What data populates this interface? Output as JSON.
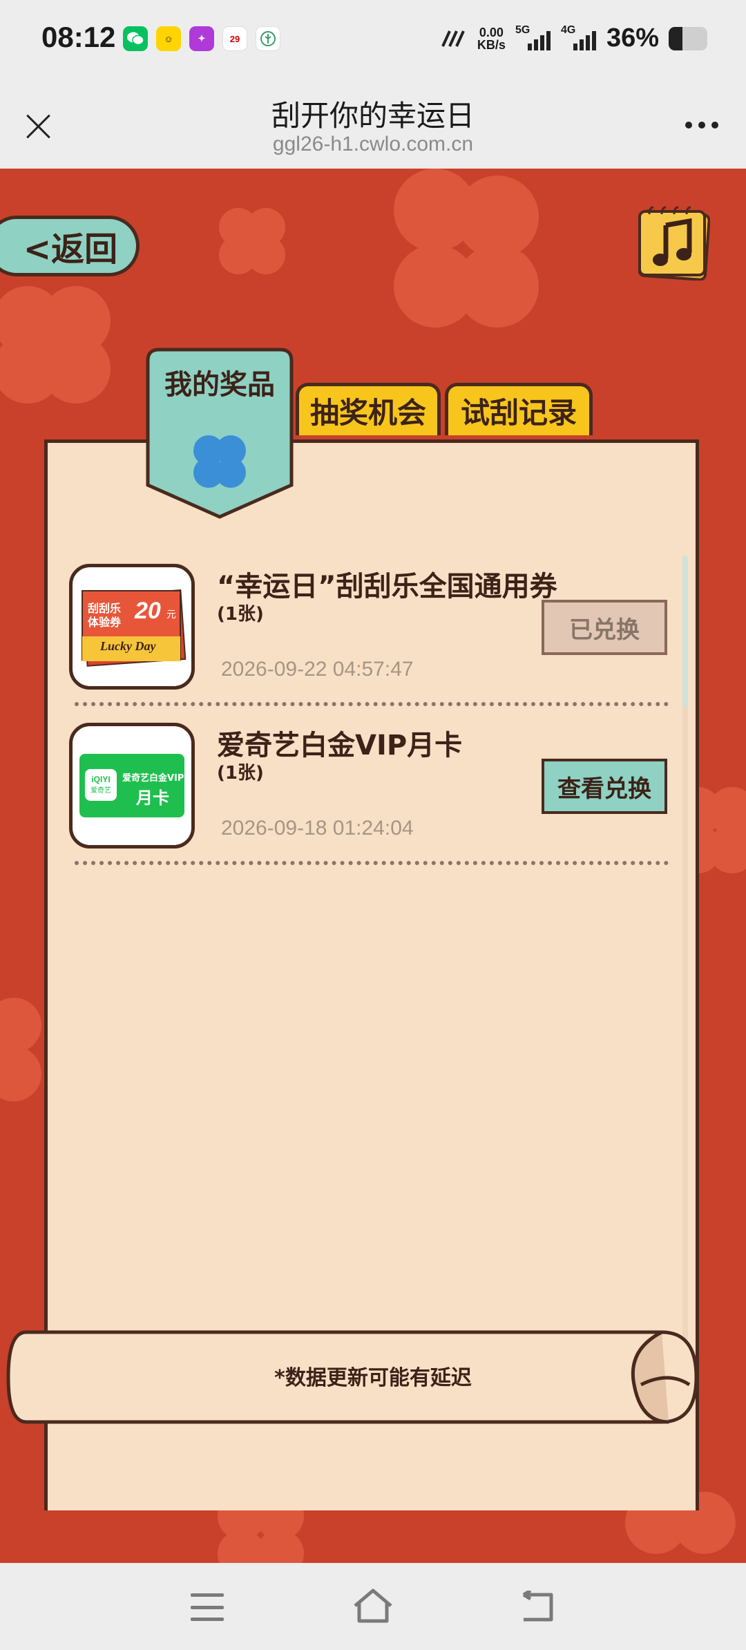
{
  "status_bar": {
    "time": "08:12",
    "net_speed_value": "0.00",
    "net_speed_unit": "KB/s",
    "sim1_label": "5G",
    "sim2_label": "4G",
    "battery_percent": "36%",
    "notif_text_4": "29"
  },
  "title_bar": {
    "title": "刮开你的幸运日",
    "url": "ggl26-h1.cwlo.com.cn"
  },
  "game": {
    "back_label": "<返回",
    "tabs": {
      "active": "我的奖品",
      "draw_chances": "抽奖机会",
      "scratch_records": "试刮记录"
    },
    "prizes": [
      {
        "name": "“幸运日”刮刮乐全国通用券",
        "qty": "(1张)",
        "date": "2026-09-22 04:57:47",
        "button": "已兑换",
        "thumb_text_top": "刮刮乐",
        "thumb_text_mid": "体验券",
        "thumb_value": "20",
        "thumb_unit": "元",
        "thumb_banner": "Lucky Day"
      },
      {
        "name": "爱奇艺白金VIP月卡",
        "qty": "(1张)",
        "date": "2026-09-18 01:24:04",
        "button": "查看兑换",
        "thumb_logo_top": "iQIYI",
        "thumb_logo_bottom": "爱奇艺",
        "thumb_line1": "爱奇艺白金VIP",
        "thumb_line2": "月卡"
      }
    ],
    "note": "*数据更新可能有延迟"
  },
  "colors": {
    "background": "#c9412a",
    "panel": "#f7e0c6",
    "accent_teal": "#8fd1c3",
    "tab_yellow": "#f7c51c",
    "outline": "#4a2a1e"
  }
}
